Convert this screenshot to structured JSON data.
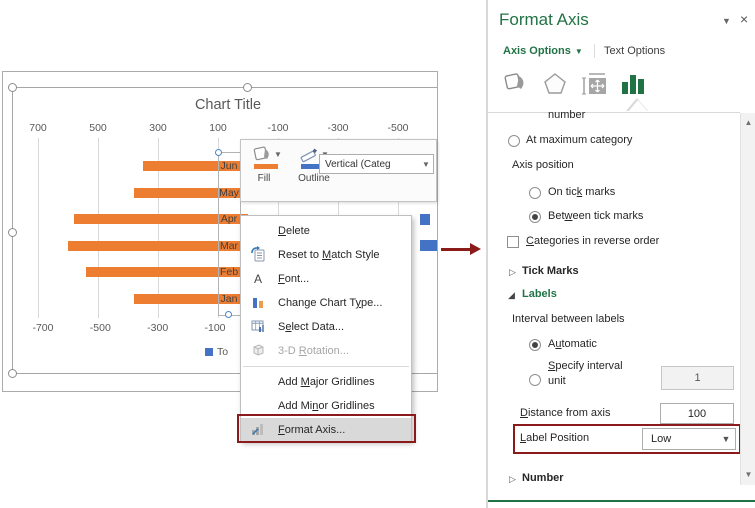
{
  "annotation_color": "#8b1b1b",
  "chart": {
    "title": "Chart Title",
    "legend_label": "To",
    "chart_data": {
      "type": "bar",
      "orientation": "horizontal",
      "categories": [
        "Jan",
        "Feb",
        "Mar",
        "Apr",
        "May",
        "Jun"
      ],
      "series": [
        {
          "name": "Total",
          "color": "#ED7D31",
          "values": [
            380,
            540,
            600,
            580,
            380,
            350
          ]
        }
      ],
      "secondary_color": "#4472C4",
      "secondary_visible_segments": [
        {
          "category": "Apr",
          "from": 583,
          "to": 617
        },
        {
          "category": "Mar",
          "from": 583,
          "to": 663
        }
      ],
      "top_axis_ticks": [
        700,
        500,
        300,
        100,
        -100,
        -300,
        -500
      ],
      "bottom_axis_ticks": [
        -700,
        -500,
        -300,
        -100
      ],
      "title": "Chart Title",
      "grid": true,
      "legend_position": "bottom"
    }
  },
  "mini_toolbar": {
    "fill_label": "Fill",
    "outline_label": "Outline",
    "fill_color": "#ED7D31",
    "outline_color": "#4472C4",
    "dropdown_value": "Vertical (Categ",
    "caret": "▼"
  },
  "context_menu": {
    "items": [
      {
        "pre": "",
        "key": "D",
        "post": "elete"
      },
      {
        "pre": "Reset to ",
        "key": "M",
        "post": "atch Style"
      },
      {
        "pre": "",
        "key": "F",
        "post": "ont..."
      },
      {
        "pre": "Change Chart T",
        "key": "y",
        "post": "pe..."
      },
      {
        "pre": "S",
        "key": "e",
        "post": "lect Data..."
      },
      {
        "pre": "3-D ",
        "key": "R",
        "post": "otation..."
      },
      {
        "pre": "Add ",
        "key": "M",
        "post": "ajor Gridlines"
      },
      {
        "pre": "Add Mi",
        "key": "n",
        "post": "or Gridlines"
      },
      {
        "pre": "",
        "key": "F",
        "post": "ormat Axis..."
      }
    ]
  },
  "pane": {
    "title": "Format Axis",
    "collapse_glyph": "▼",
    "close_glyph": "×",
    "tab_axis_options": "Axis Options",
    "tab_axis_options_caret": "▼",
    "tab_text_options": "Text Options",
    "clipped_text": "number",
    "at_max": {
      "pre": "At maximum cate",
      "key": "g",
      "post": "ory"
    },
    "axis_position": "Axis position",
    "on_tick": {
      "pre": "On tic",
      "key": "k",
      "post": " marks"
    },
    "between_tick": {
      "pre": "Bet",
      "key": "w",
      "post": "een tick marks"
    },
    "categories_reverse": {
      "pre": "",
      "key": "C",
      "post": "ategories in reverse order"
    },
    "tick_marks": "Tick Marks",
    "labels": "Labels",
    "interval_between": "Interval between labels",
    "automatic": {
      "pre": "A",
      "key": "u",
      "post": "tomatic"
    },
    "specify": {
      "pre": "",
      "key": "S",
      "post": "pecify interval"
    },
    "specify_line2": "unit",
    "specify_value": "1",
    "distance": {
      "pre": "",
      "key": "D",
      "post": "istance from axis"
    },
    "distance_value": "100",
    "label_position": {
      "pre": "",
      "key": "L",
      "post": "abel Position"
    },
    "label_position_value": "Low",
    "number": "Number",
    "collapsed_glyph": "▷",
    "expanded_glyph": "◢"
  }
}
